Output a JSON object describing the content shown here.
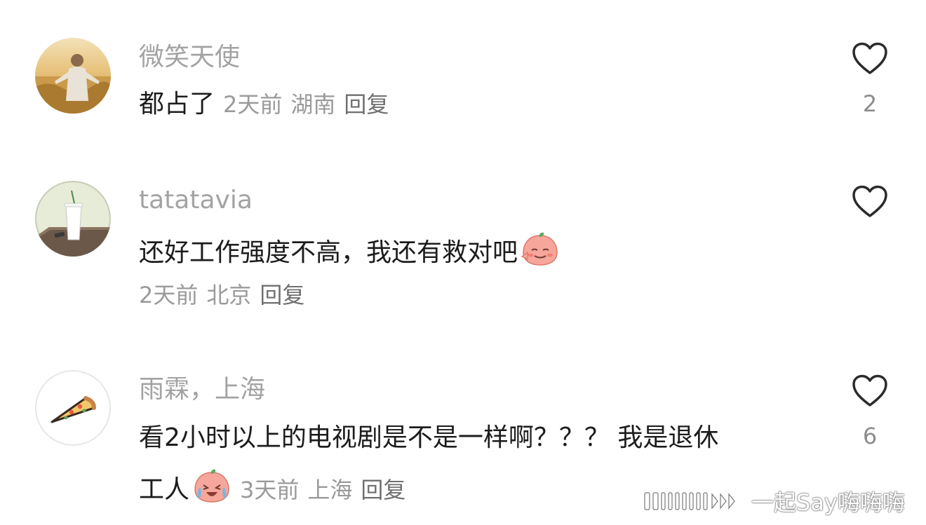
{
  "comments": [
    {
      "username": "微笑天使",
      "text": "都占了",
      "time": "2天前",
      "location": "湖南",
      "reply": "回复",
      "likes": "2",
      "avatar": "wheat-field-person-avatar"
    },
    {
      "username": "tatatavia",
      "text": "还好工作强度不高，我还有救对吧",
      "time": "2天前",
      "location": "北京",
      "reply": "回复",
      "likes": "",
      "emoji": "shy-peach-emoji",
      "avatar": "coffee-cup-avatar"
    },
    {
      "username": "雨霖，上海",
      "text_line1": "看2小时以上的电视剧是不是一样啊？？？ 我是退休",
      "text_line2": "工人",
      "time": "3天前",
      "location": "上海",
      "reply": "回复",
      "likes": "6",
      "emoji": "crying-peach-emoji",
      "avatar": "pizza-slice-avatar"
    }
  ],
  "watermark": "一起Say嗨嗨嗨",
  "colors": {
    "username": "#a3a3a3",
    "text": "#1c1c1c",
    "meta": "#9a9a9a",
    "heart": "#2b2b2b"
  }
}
